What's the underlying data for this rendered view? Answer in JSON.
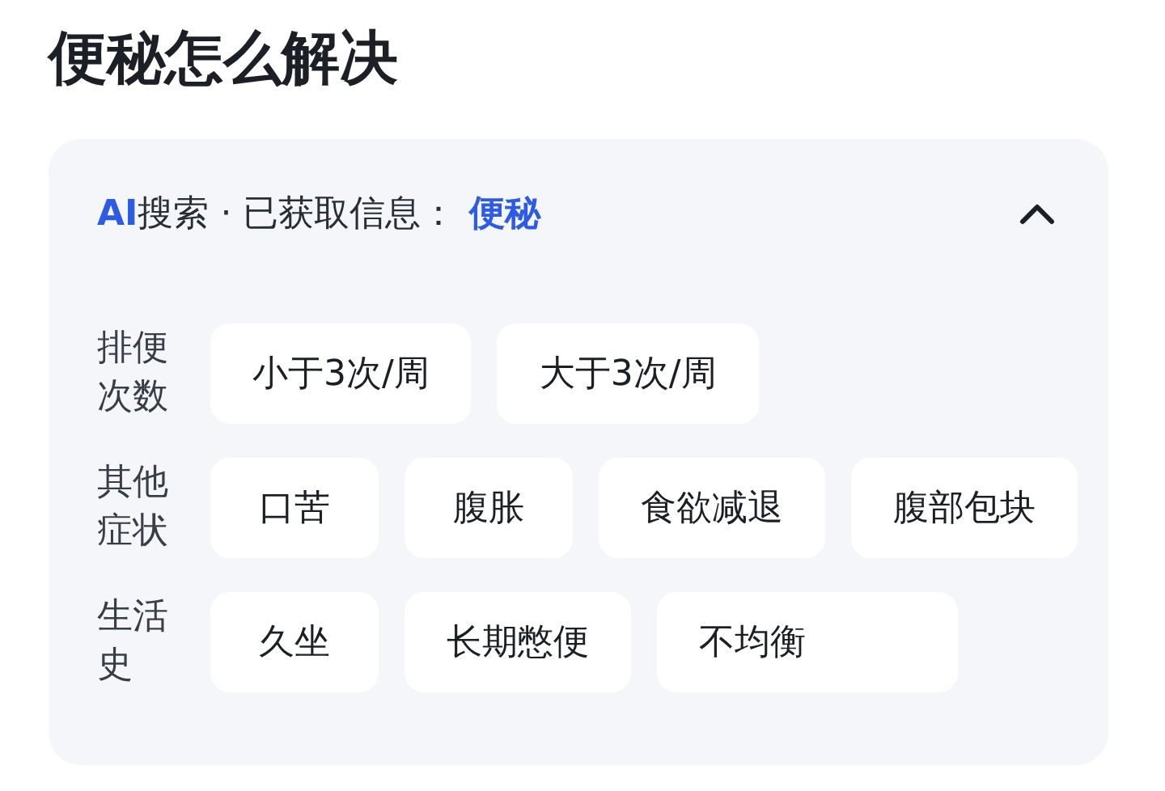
{
  "title": "便秘怎么解决",
  "panel": {
    "brand": "AI",
    "brand_rest": "搜索",
    "info_label": "· 已获取信息：",
    "keyword": "便秘",
    "expanded": true
  },
  "groups": [
    {
      "label": "排便次数",
      "options": [
        "小于3次/周",
        "大于3次/周"
      ]
    },
    {
      "label": "其他症状",
      "options": [
        "口苦",
        "腹胀",
        "食欲减退",
        "腹部包块"
      ]
    },
    {
      "label": "生活史",
      "options": [
        "久坐",
        "长期憋便",
        "不均衡"
      ]
    }
  ]
}
